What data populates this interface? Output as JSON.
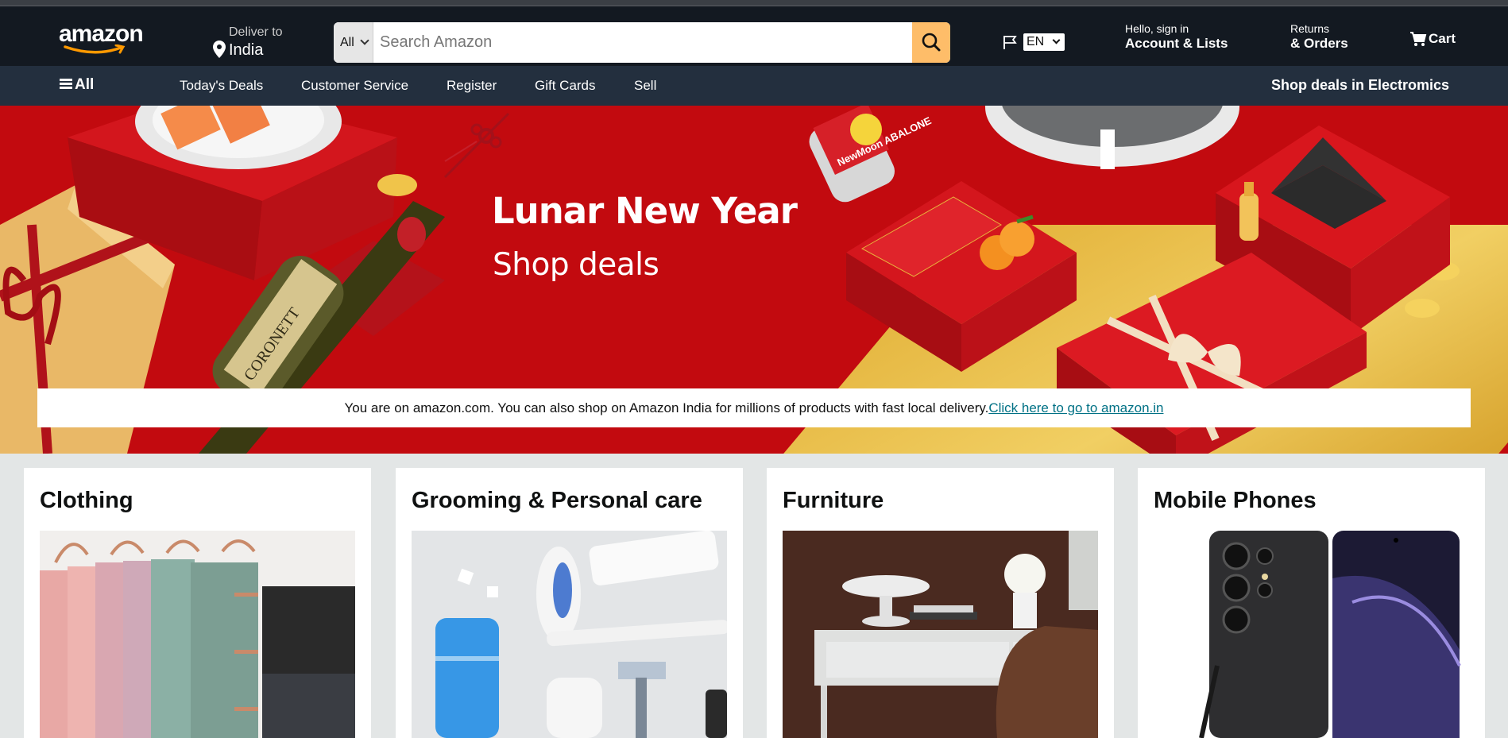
{
  "header": {
    "logo": "amazon",
    "deliver_to_label": "Deliver to",
    "deliver_to_location": "India",
    "search": {
      "category": "All",
      "placeholder": "Search Amazon"
    },
    "language": "EN",
    "account_line1": "Hello, sign in",
    "account_line2": "Account & Lists",
    "orders_line1": "Returns",
    "orders_line2": "& Orders",
    "cart_label": "Cart"
  },
  "nav": {
    "all_label": "All",
    "items": [
      "Today's Deals",
      "Customer Service",
      "Register",
      "Gift Cards",
      "Sell"
    ],
    "promo": "Shop deals in Electromics"
  },
  "hero": {
    "title": "Lunar New Year",
    "subtitle": "Shop deals",
    "product_labels": [
      "NewMoon ABALONE",
      "CORONETT"
    ]
  },
  "notice": {
    "text": "You are on amazon.com. You can also shop on Amazon India for millions of products with fast local delivery.",
    "link": "Click here to go to amazon.in"
  },
  "cards": [
    {
      "title": "Clothing"
    },
    {
      "title": "Grooming & Personal care"
    },
    {
      "title": "Furniture"
    },
    {
      "title": "Mobile Phones"
    }
  ],
  "colors": {
    "header_bg": "#131921",
    "nav_bg": "#232f3e",
    "search_button": "#febd69",
    "hero_red": "#c20a0f",
    "link": "#007185",
    "page_bg": "#e3e6e6"
  },
  "icons": [
    "location-pin-icon",
    "search-icon",
    "flag-icon",
    "chevron-down-icon",
    "cart-icon",
    "hamburger-icon"
  ]
}
